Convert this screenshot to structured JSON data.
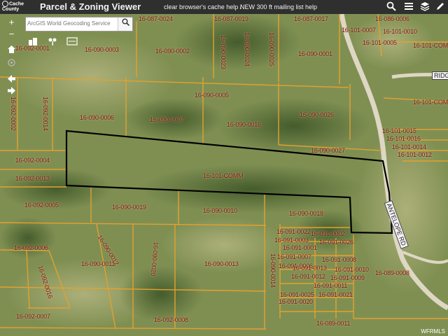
{
  "header": {
    "logo_text": "Cache County",
    "title": "Parcel & Zoning Viewer",
    "link_cache_help": "clear browser's cache help /",
    "link_mailing": "NEW 300 ft mailing list help",
    "icons": [
      "search-icon",
      "menu-icon",
      "layers-icon",
      "edit-icon"
    ]
  },
  "search": {
    "placeholder": "ArcGIS World Geocoding Service",
    "button_icon": "search-icon"
  },
  "map_controls": [
    "zoom-in",
    "zoom-out",
    "home",
    "locate",
    "back",
    "forward"
  ],
  "toolbar_icons": [
    "buildings-icon",
    "tree-icon",
    "scale-icon"
  ],
  "parcels": [
    {
      "id": "p1",
      "label": "16-087-0024"
    },
    {
      "id": "p2",
      "label": "16-087-0019"
    },
    {
      "id": "p3",
      "label": "16-087-0017"
    },
    {
      "id": "p4",
      "label": "16-086-0006"
    },
    {
      "id": "p5",
      "label": "16-101-0007"
    },
    {
      "id": "p6",
      "label": "16-101-0010"
    },
    {
      "id": "p7",
      "label": "16-101-0005"
    },
    {
      "id": "p8",
      "label": "16-101-COM"
    },
    {
      "id": "p9",
      "label": "16-092-0001"
    },
    {
      "id": "p10",
      "label": "16-090-0003"
    },
    {
      "id": "p11",
      "label": "16-090-0002"
    },
    {
      "id": "p12",
      "label": "16-090-0023"
    },
    {
      "id": "p13",
      "label": "16-090-0024"
    },
    {
      "id": "p14",
      "label": "16-090-0025"
    },
    {
      "id": "p15",
      "label": "16-090-0001"
    },
    {
      "id": "p16",
      "label": "16-090-0005"
    },
    {
      "id": "p17",
      "label": "16-092-0002"
    },
    {
      "id": "p18",
      "label": "16-092-0014"
    },
    {
      "id": "p19",
      "label": "16-090-0006"
    },
    {
      "id": "p20",
      "label": "16-090-0007"
    },
    {
      "id": "p21",
      "label": "16-090-0016"
    },
    {
      "id": "p22",
      "label": "16-090-0026"
    },
    {
      "id": "p23",
      "label": "16-101-COM"
    },
    {
      "id": "p24",
      "label": "16-101-0015"
    },
    {
      "id": "p25",
      "label": "16-101-0016"
    },
    {
      "id": "p26",
      "label": "16-101-0014"
    },
    {
      "id": "p27",
      "label": "16-101-0012"
    },
    {
      "id": "p28",
      "label": "16-090-0027"
    },
    {
      "id": "p29",
      "label": "16-092-0004"
    },
    {
      "id": "p30",
      "label": "16-101-COMM"
    },
    {
      "id": "p31",
      "label": "16-092-0013"
    },
    {
      "id": "p32",
      "label": "16-092-0005"
    },
    {
      "id": "p33",
      "label": "16-090-0019"
    },
    {
      "id": "p34",
      "label": "16-090-0010"
    },
    {
      "id": "p35",
      "label": "16-090-0018"
    },
    {
      "id": "p36",
      "label": "16-090-0012"
    },
    {
      "id": "p37",
      "label": "16-090-0020"
    },
    {
      "id": "p38",
      "label": "16-092-0006"
    },
    {
      "id": "p39",
      "label": "16-090-0011"
    },
    {
      "id": "p40",
      "label": "16-092-0016"
    },
    {
      "id": "p41",
      "label": "16-090-0013"
    },
    {
      "id": "p42",
      "label": "16-090-0014"
    },
    {
      "id": "p43",
      "label": "16-091-0022"
    },
    {
      "id": "p44",
      "label": "16-091-0003"
    },
    {
      "id": "p45",
      "label": "16-091-0001"
    },
    {
      "id": "p46",
      "label": "16-091-0002"
    },
    {
      "id": "p47",
      "label": "16-091-0026"
    },
    {
      "id": "p48",
      "label": "16-091-0007"
    },
    {
      "id": "p49",
      "label": "16-091-0008"
    },
    {
      "id": "p50",
      "label": "16-091-0006"
    },
    {
      "id": "p51",
      "label": "16-091-0013"
    },
    {
      "id": "p52",
      "label": "16-091-0010"
    },
    {
      "id": "p53",
      "label": "16-091-0012"
    },
    {
      "id": "p54",
      "label": "16-091-0009"
    },
    {
      "id": "p55",
      "label": "16-091-0011"
    },
    {
      "id": "p56",
      "label": "16-091-0025"
    },
    {
      "id": "p57",
      "label": "16-091-0021"
    },
    {
      "id": "p58",
      "label": "16-091-0020"
    },
    {
      "id": "p59",
      "label": "16-089-0008"
    },
    {
      "id": "p60",
      "label": "16-092-0007"
    },
    {
      "id": "p61",
      "label": "16-092-0008"
    },
    {
      "id": "p62",
      "label": "16-089-0011"
    }
  ],
  "roads": {
    "ridge": "RIDG",
    "antelope": "ANTELOPE RD"
  },
  "attribution": "WFRMLS"
}
